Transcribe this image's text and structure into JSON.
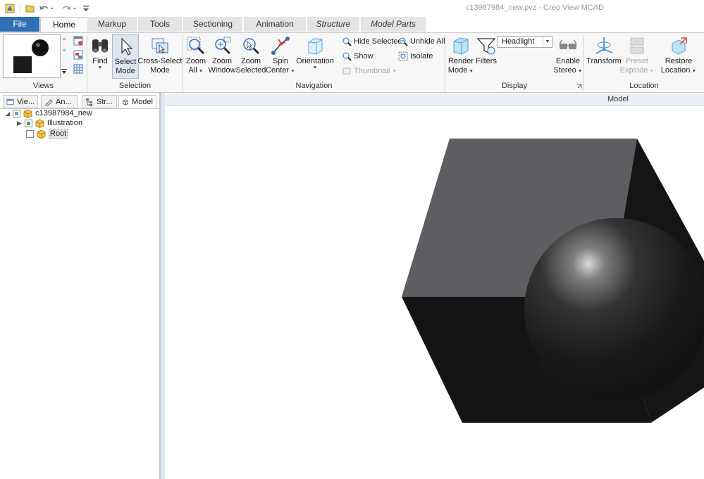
{
  "window": {
    "title": "c13987984_new.pvz - Creo View MCAD"
  },
  "quick_access": {
    "icons": [
      "app-icon",
      "open-folder-icon",
      "undo-icon",
      "redo-icon",
      "customize-icon"
    ]
  },
  "tabs": [
    {
      "label": "File"
    },
    {
      "label": "Home"
    },
    {
      "label": "Markup"
    },
    {
      "label": "Tools"
    },
    {
      "label": "Sectioning"
    },
    {
      "label": "Animation"
    },
    {
      "label": "Structure"
    },
    {
      "label": "Model Parts"
    }
  ],
  "ribbon": {
    "groups": {
      "views": "Views",
      "selection": "Selection",
      "navigation": "Navigation",
      "display": "Display",
      "location": "Location"
    },
    "selection": {
      "find": "Find",
      "select_mode": [
        "Select",
        "Mode"
      ],
      "cross_select_mode": [
        "Cross-Select",
        "Mode"
      ]
    },
    "navigation": {
      "zoom_all": [
        "Zoom",
        "All"
      ],
      "zoom_window": [
        "Zoom",
        "Window"
      ],
      "zoom_selected": [
        "Zoom",
        "Selected"
      ],
      "spin_center": [
        "Spin",
        "Center"
      ],
      "orientation": "Orientation",
      "hide_selected": "Hide Selected",
      "unhide_all": "Unhide All",
      "show": "Show",
      "isolate": "Isolate",
      "thumbnail": "Thumbnail"
    },
    "display": {
      "render_mode": [
        "Render",
        "Mode"
      ],
      "filters": "Filters",
      "lighting_value": "Headlight",
      "enable_stereo": [
        "Enable",
        "Stereo"
      ]
    },
    "location": {
      "transform": "Transform",
      "preset_explode": [
        "Preset",
        "Explode"
      ],
      "restore_location": [
        "Restore",
        "Location"
      ]
    }
  },
  "panel_tabs": [
    {
      "label": "Vie..."
    },
    {
      "label": "An..."
    },
    {
      "label": "Str..."
    },
    {
      "label": "Model"
    }
  ],
  "tree": {
    "root": "c13987984_new",
    "children": [
      {
        "label": "Illustration"
      },
      {
        "label": "Root"
      }
    ]
  },
  "viewport": {
    "title": "Model"
  },
  "colors": {
    "file_tab": "#2f6fb3",
    "cube_top": "#5e5e62",
    "cube_side": "#151515",
    "sphere": "#262626"
  }
}
